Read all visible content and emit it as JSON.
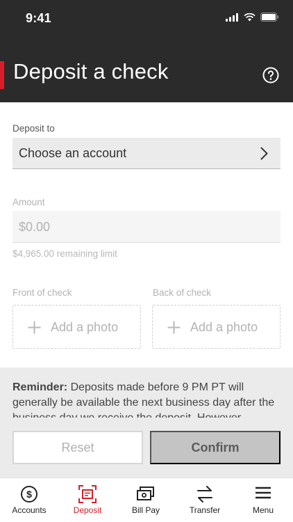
{
  "status": {
    "time": "9:41"
  },
  "header": {
    "title": "Deposit a check",
    "help_icon": "question-circle-icon"
  },
  "form": {
    "deposit_to_label": "Deposit to",
    "account_value": "Choose an account",
    "amount_label": "Amount",
    "amount_placeholder": "$0.00",
    "limit_text": "$4,965.00 remaining limit",
    "front_label": "Front of check",
    "back_label": "Back of check",
    "add_photo": "Add a photo"
  },
  "reminder": {
    "title": "Reminder:",
    "text": " Deposits made before 9 PM PT will generally be available the next business day after the business day we receive the deposit. However,"
  },
  "actions": {
    "reset": "Reset",
    "confirm": "Confirm"
  },
  "tabs": [
    {
      "label": "Accounts",
      "icon": "dollar-circle-icon"
    },
    {
      "label": "Deposit",
      "icon": "deposit-scan-icon",
      "active": true
    },
    {
      "label": "Bill Pay",
      "icon": "bill-pay-icon"
    },
    {
      "label": "Transfer",
      "icon": "transfer-arrows-icon"
    },
    {
      "label": "Menu",
      "icon": "hamburger-menu-icon"
    }
  ],
  "colors": {
    "brand_red": "#d71e28",
    "header_bg": "#2b2b2b"
  }
}
